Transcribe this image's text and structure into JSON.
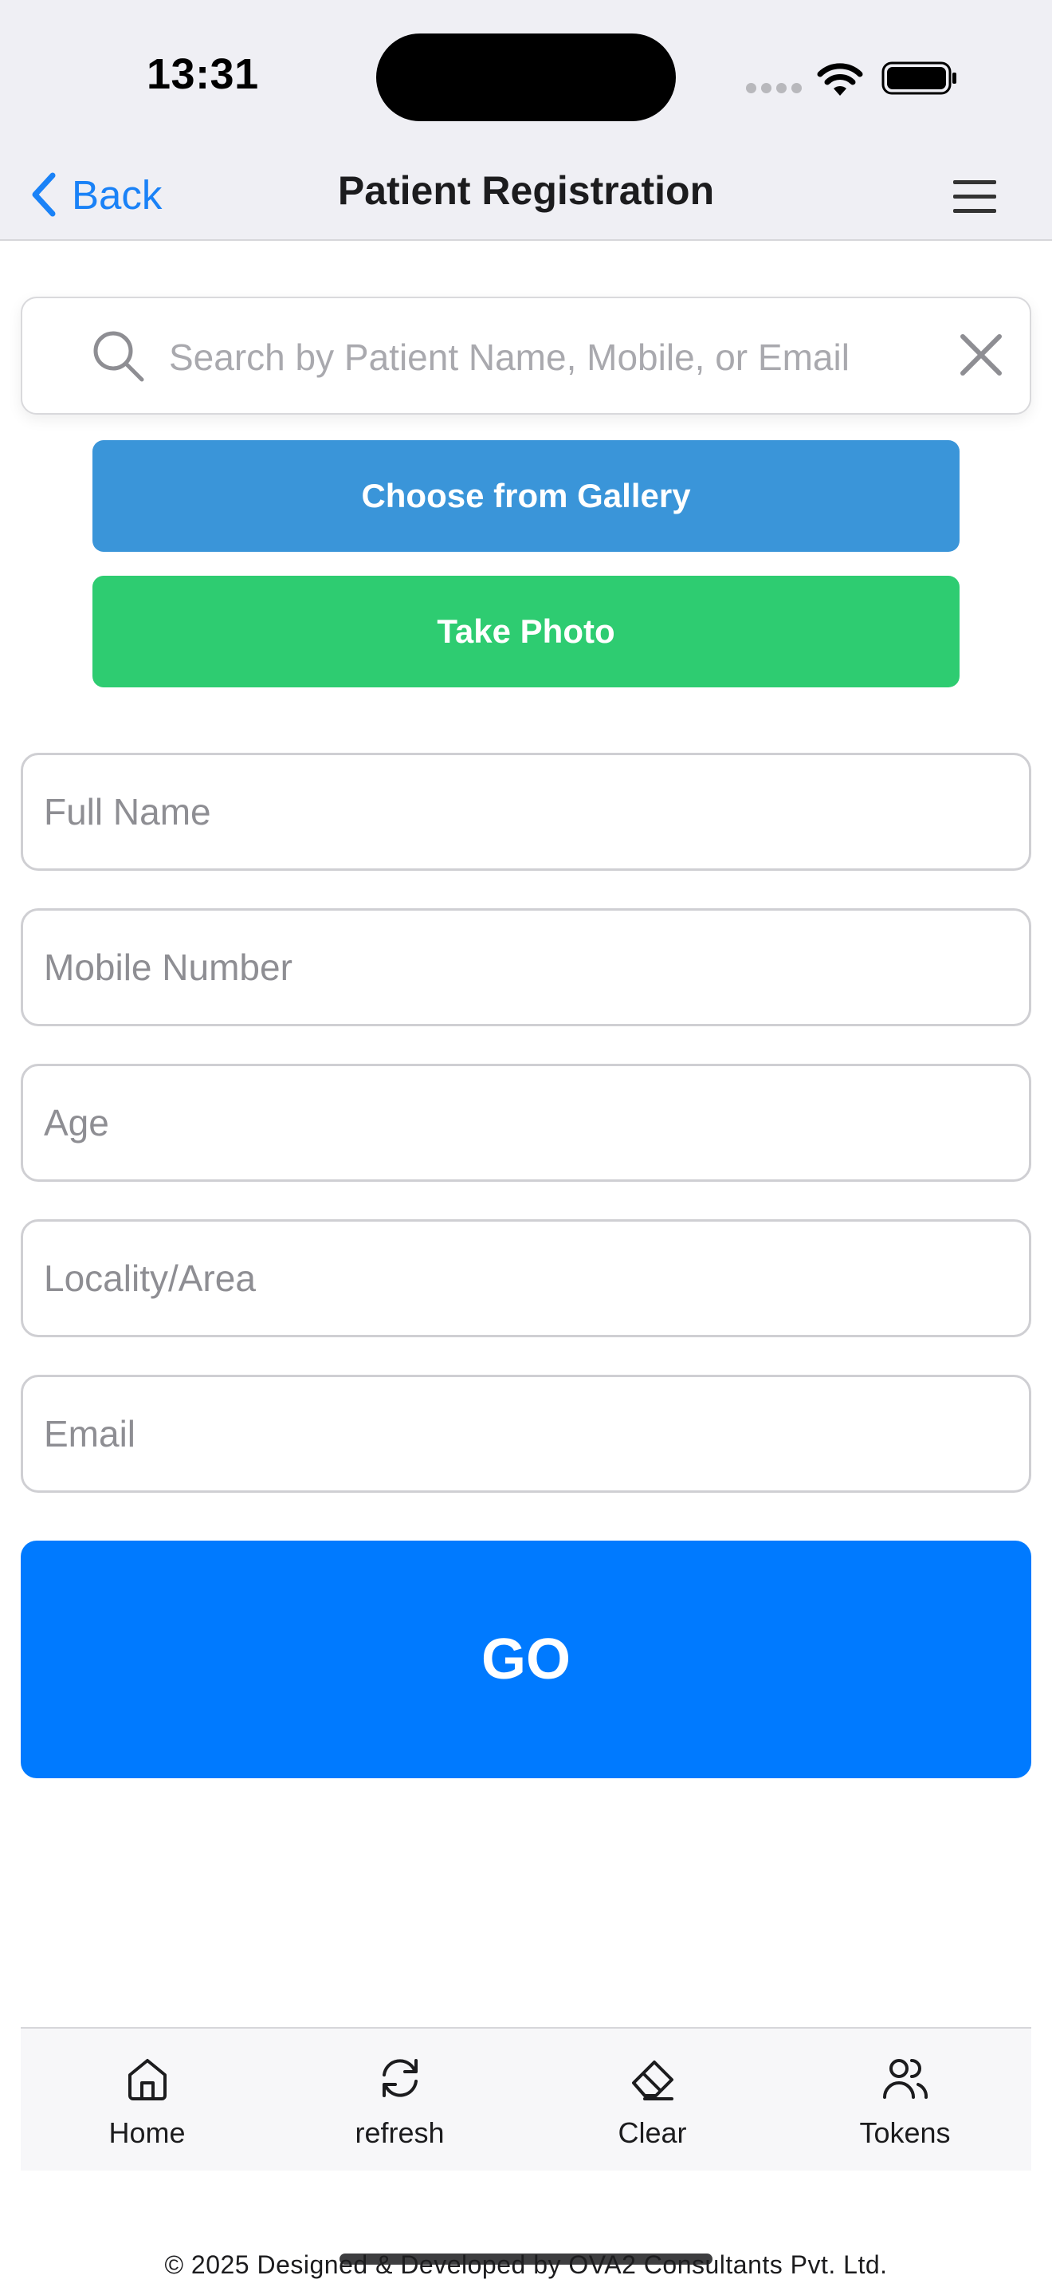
{
  "status_bar": {
    "time": "13:31"
  },
  "nav": {
    "back_label": "Back",
    "title": "Patient Registration"
  },
  "search": {
    "placeholder": "Search by Patient Name, Mobile, or Email",
    "value": ""
  },
  "actions": {
    "gallery_label": "Choose from Gallery",
    "photo_label": "Take Photo"
  },
  "form": {
    "fields": [
      {
        "placeholder": "Full Name",
        "value": ""
      },
      {
        "placeholder": "Mobile Number",
        "value": ""
      },
      {
        "placeholder": "Age",
        "value": ""
      },
      {
        "placeholder": "Locality/Area",
        "value": ""
      },
      {
        "placeholder": "Email",
        "value": ""
      }
    ],
    "submit_label": "GO"
  },
  "tabs": [
    {
      "label": "Home",
      "icon": "home-icon"
    },
    {
      "label": "refresh",
      "icon": "refresh-icon"
    },
    {
      "label": "Clear",
      "icon": "eraser-icon"
    },
    {
      "label": "Tokens",
      "icon": "users-icon"
    }
  ],
  "footer": {
    "text": "© 2025 Designed & Developed by OVA2 Consultants Pvt. Ltd."
  },
  "colors": {
    "accent": "#007aff",
    "back_link": "#1a82f7",
    "gallery_button": "#3a95d9",
    "photo_button": "#2ecc71"
  }
}
